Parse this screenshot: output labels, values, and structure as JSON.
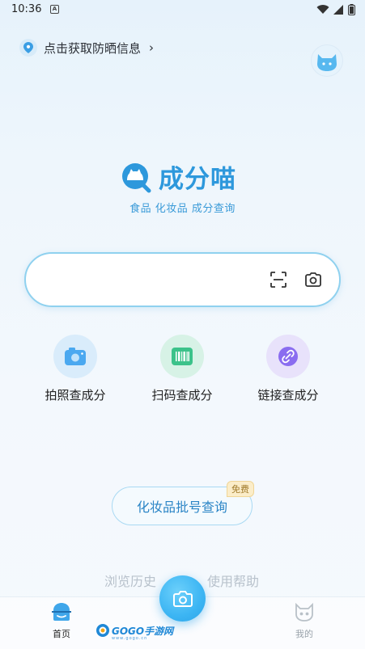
{
  "status_bar": {
    "time": "10:36",
    "notif_letter": "A"
  },
  "location": {
    "text": "点击获取防晒信息",
    "chevron": "›"
  },
  "brand": {
    "name": "成分喵",
    "tagline": "食品 化妆品 成分查询"
  },
  "search": {
    "placeholder": ""
  },
  "features": [
    {
      "label": "拍照查成分",
      "icon": "camera-icon",
      "color": "#4aa8f0"
    },
    {
      "label": "扫码查成分",
      "icon": "barcode-icon",
      "color": "#3cc28a"
    },
    {
      "label": "链接查成分",
      "icon": "link-icon",
      "color": "#8a6df0"
    }
  ],
  "batch": {
    "label": "化妆品批号查询",
    "badge": "免费"
  },
  "links": {
    "history": "浏览历史",
    "help": "使用帮助"
  },
  "nav": {
    "home": "首页",
    "mine": "我的"
  },
  "watermark": {
    "brand": "GOGO手游网",
    "url": "www.gogo.cn"
  },
  "colors": {
    "accent": "#2d98dc",
    "border": "#8fd1ef"
  }
}
